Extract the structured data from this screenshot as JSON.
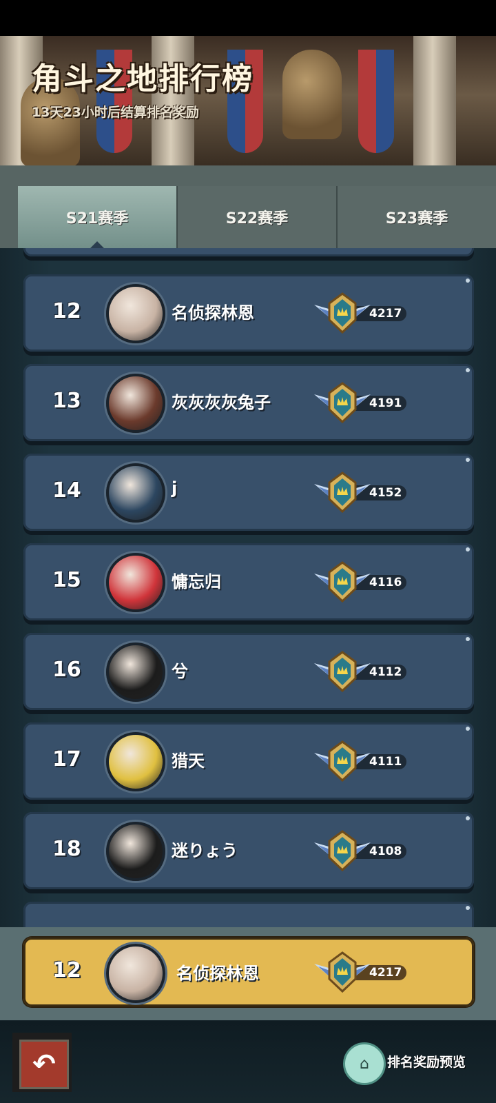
{
  "header": {
    "title": "角斗之地排行榜",
    "subtitle": "13天23小时后结算排名奖励"
  },
  "tabs": [
    {
      "label": "S21赛季",
      "active": true
    },
    {
      "label": "S22赛季",
      "active": false
    },
    {
      "label": "S23赛季",
      "active": false
    }
  ],
  "ranking": [
    {
      "rank": "12",
      "name": "名侦探林恩",
      "score": "4217",
      "avatar_color": "#c8b3a4"
    },
    {
      "rank": "13",
      "name": "灰灰灰灰兔子",
      "score": "4191",
      "avatar_color": "#6b3a2c"
    },
    {
      "rank": "14",
      "name": "j",
      "score": "4152",
      "avatar_color": "#2c4660"
    },
    {
      "rank": "15",
      "name": "慵忘归",
      "score": "4116",
      "avatar_color": "#d0343a"
    },
    {
      "rank": "16",
      "name": "兮",
      "score": "4112",
      "avatar_color": "#1c1c1c"
    },
    {
      "rank": "17",
      "name": "猎天",
      "score": "4111",
      "avatar_color": "#e0c040"
    },
    {
      "rank": "18",
      "name": "迷りょう",
      "score": "4108",
      "avatar_color": "#1c1c1c"
    }
  ],
  "my_rank": {
    "rank": "12",
    "name": "名侦探林恩",
    "score": "4217",
    "avatar_color": "#c8b3a4"
  },
  "footer": {
    "back_icon": "back-arrow-icon",
    "reward_preview_label": "排名奖励预览"
  },
  "colors": {
    "row": "#38506a",
    "my_row": "#e3b952",
    "active_tab": "#8aa9a1"
  }
}
